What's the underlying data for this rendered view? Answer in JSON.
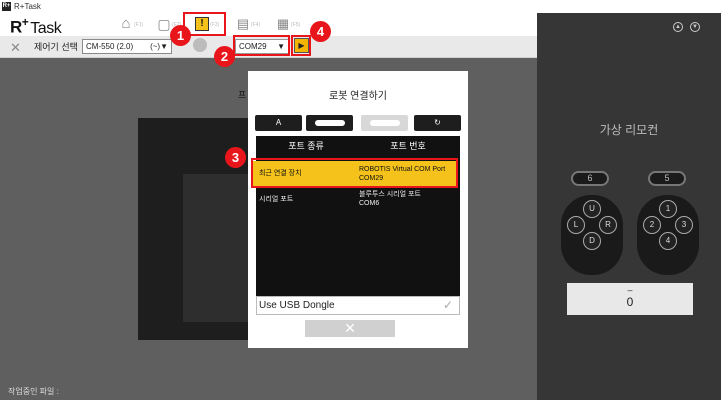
{
  "window": {
    "title": "R+Task",
    "app_icon": "R+"
  },
  "logo": {
    "main": "R",
    "plus": "+",
    "word": "Task"
  },
  "toolbar": {
    "icons": [
      {
        "name": "home-icon",
        "glyph": "⌂",
        "small": "(F1)"
      },
      {
        "name": "monitor-icon",
        "glyph": "▢",
        "small": "(F2)"
      },
      {
        "name": "alert-monitor-icon",
        "glyph": "!",
        "small": "(F3)"
      },
      {
        "name": "film-icon",
        "glyph": "▤",
        "small": "(F4)"
      },
      {
        "name": "clapper-icon",
        "glyph": "▦",
        "small": "(F5)"
      }
    ]
  },
  "ctrlbar": {
    "label": "제어기 선택",
    "controller_value": "CM-550 (2.0)",
    "controller_suffix": "(~)▼",
    "port_value": "COM29",
    "port_arrow": "▼",
    "play_glyph": "▶"
  },
  "badges": [
    "1",
    "2",
    "3",
    "4"
  ],
  "main": {
    "partial_char": "프",
    "status_label": "작업중인 파일 :"
  },
  "dialog": {
    "title": "로봇 연결하기",
    "col_port_type": "포트 종류",
    "col_port_number": "포트 번호",
    "rows": [
      {
        "type": "최근 연결 장치",
        "number_line1": "ROBOTIS Virtual COM Port",
        "number_line2": "COM29",
        "selected": true
      },
      {
        "type": "시리얼 포트",
        "number_line1": "블루투스 시리얼 포트",
        "number_line2": "COM6",
        "selected": false
      }
    ],
    "conn_buttons": [
      "A",
      "",
      "",
      "↻"
    ],
    "usb_label": "Use USB Dongle",
    "usb_check": "✓",
    "close_glyph": "✕"
  },
  "remote": {
    "title": "가상 리모컨",
    "top_icons": [
      "▲",
      "▼"
    ],
    "left_pill": "6",
    "right_pill": "5",
    "left_pad": [
      "U",
      "L",
      "R",
      "D"
    ],
    "right_pad": [
      "1",
      "2",
      "3",
      "4"
    ],
    "display_dash": "–",
    "display_value": "0"
  },
  "colors": {
    "accent": "#f4c21a",
    "highlight": "#e8161b",
    "panel": "#363636"
  }
}
